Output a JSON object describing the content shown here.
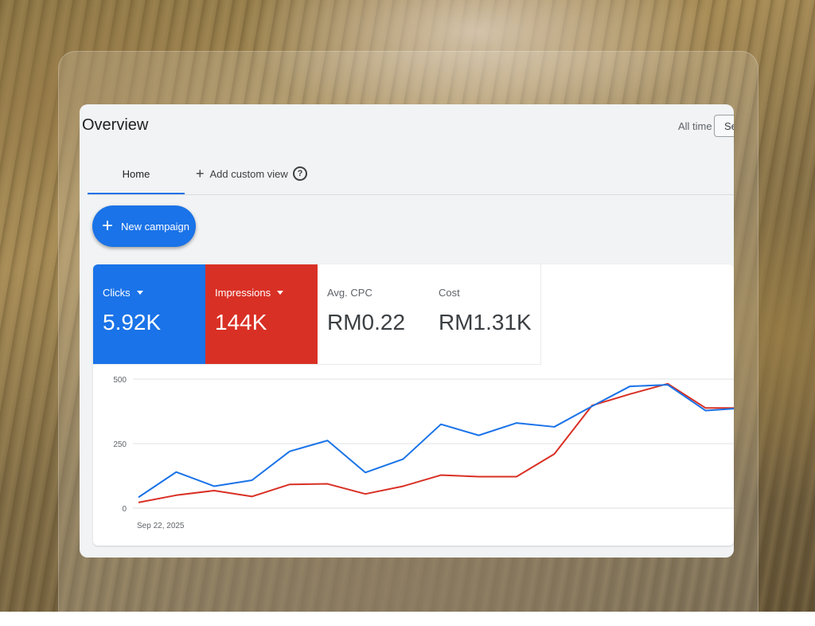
{
  "header": {
    "title": "Overview",
    "range_label": "All time",
    "date_button_label": "Se"
  },
  "tabs": {
    "home": "Home",
    "add_custom_view": "Add custom view"
  },
  "actions": {
    "new_campaign": "New campaign"
  },
  "metrics": [
    {
      "label": "Clicks",
      "value": "5.92K",
      "color": "#1a73e8",
      "selected": true
    },
    {
      "label": "Impressions",
      "value": "144K",
      "color": "#d93025",
      "selected": true
    },
    {
      "label": "Avg. CPC",
      "value": "RM0.22",
      "selected": false
    },
    {
      "label": "Cost",
      "value": "RM1.31K",
      "selected": false
    }
  ],
  "chart_data": {
    "type": "line",
    "x": [
      "Sep 22, 2025",
      "",
      "",
      "",
      "",
      "",
      "",
      "",
      "",
      "",
      "",
      "",
      "",
      "",
      "",
      "",
      "",
      ""
    ],
    "x_tick_labels": [
      "Sep 22, 2025"
    ],
    "y_ticks": [
      0,
      250,
      500
    ],
    "ylim": [
      0,
      500
    ],
    "grid": true,
    "series": [
      {
        "values": [
          42,
          140,
          85,
          108,
          220,
          262,
          138,
          190,
          325,
          282,
          330,
          315,
          395,
          472,
          478,
          378,
          388
        ],
        "color": "#1a73e8"
      },
      {
        "values": [
          22,
          50,
          68,
          45,
          92,
          94,
          55,
          85,
          128,
          122,
          122,
          210,
          398,
          442,
          482,
          388,
          388
        ],
        "color": "#d93025"
      }
    ]
  }
}
